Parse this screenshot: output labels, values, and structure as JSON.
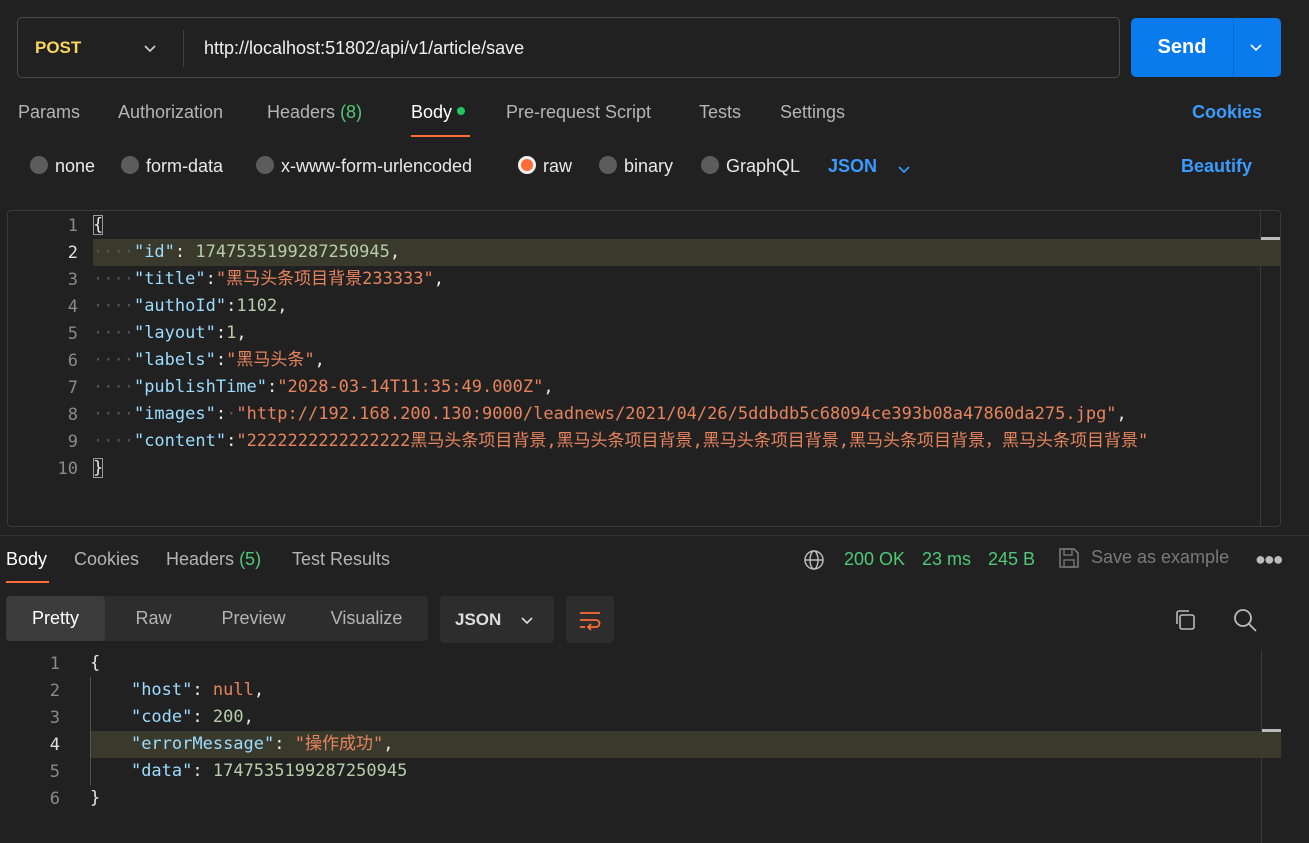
{
  "request": {
    "method": "POST",
    "url": "http://localhost:51802/api/v1/article/save",
    "send_label": "Send"
  },
  "request_tabs": {
    "params": "Params",
    "authorization": "Authorization",
    "headers": "Headers",
    "headers_count": "(8)",
    "body": "Body",
    "prerequest": "Pre-request Script",
    "tests": "Tests",
    "settings": "Settings",
    "cookies": "Cookies"
  },
  "body_types": {
    "none": "none",
    "form_data": "form-data",
    "urlencoded": "x-www-form-urlencoded",
    "raw": "raw",
    "binary": "binary",
    "graphql": "GraphQL",
    "selected": "raw",
    "language": "JSON",
    "beautify": "Beautify"
  },
  "request_body": {
    "line_numbers": [
      "1",
      "2",
      "3",
      "4",
      "5",
      "6",
      "7",
      "8",
      "9",
      "10"
    ],
    "id_key": "\"id\"",
    "id_val": "1747535199287250945",
    "title_key": "\"title\"",
    "title_val": "\"黑马头条项目背景233333\"",
    "authoId_key": "\"authoId\"",
    "authoId_val": "1102",
    "layout_key": "\"layout\"",
    "layout_val": "1",
    "labels_key": "\"labels\"",
    "labels_val": "\"黑马头条\"",
    "publishTime_key": "\"publishTime\"",
    "publishTime_val": "\"2028-03-14T11:35:49.000Z\"",
    "images_key": "\"images\"",
    "images_val": "\"http://192.168.200.130:9000/leadnews/2021/04/26/5ddbdb5c68094ce393b08a47860da275.jpg\"",
    "content_key": "\"content\"",
    "content_val": "\"2222222222222222黑马头条项目背景,黑马头条项目背景,黑马头条项目背景,黑马头条项目背景，黑马头条项目背景\""
  },
  "response_tabs": {
    "body": "Body",
    "cookies": "Cookies",
    "headers": "Headers",
    "headers_count": "(5)",
    "test_results": "Test Results"
  },
  "response_status": {
    "status": "200 OK",
    "time": "23 ms",
    "size": "245 B",
    "save_example": "Save as example"
  },
  "response_view": {
    "pretty": "Pretty",
    "raw": "Raw",
    "preview": "Preview",
    "visualize": "Visualize",
    "format": "JSON"
  },
  "response_body": {
    "line_numbers": [
      "1",
      "2",
      "3",
      "4",
      "5",
      "6"
    ],
    "host_key": "\"host\"",
    "host_val": "null",
    "code_key": "\"code\"",
    "code_val": "200",
    "errorMessage_key": "\"errorMessage\"",
    "errorMessage_val": "\"操作成功\"",
    "data_key": "\"data\"",
    "data_val": "1747535199287250945"
  },
  "colors": {
    "accent_orange": "#ff6c37",
    "primary_blue": "#097bed",
    "link_blue": "#3b9bff",
    "success_green": "#50c878",
    "method_yellow": "#f7d660"
  }
}
